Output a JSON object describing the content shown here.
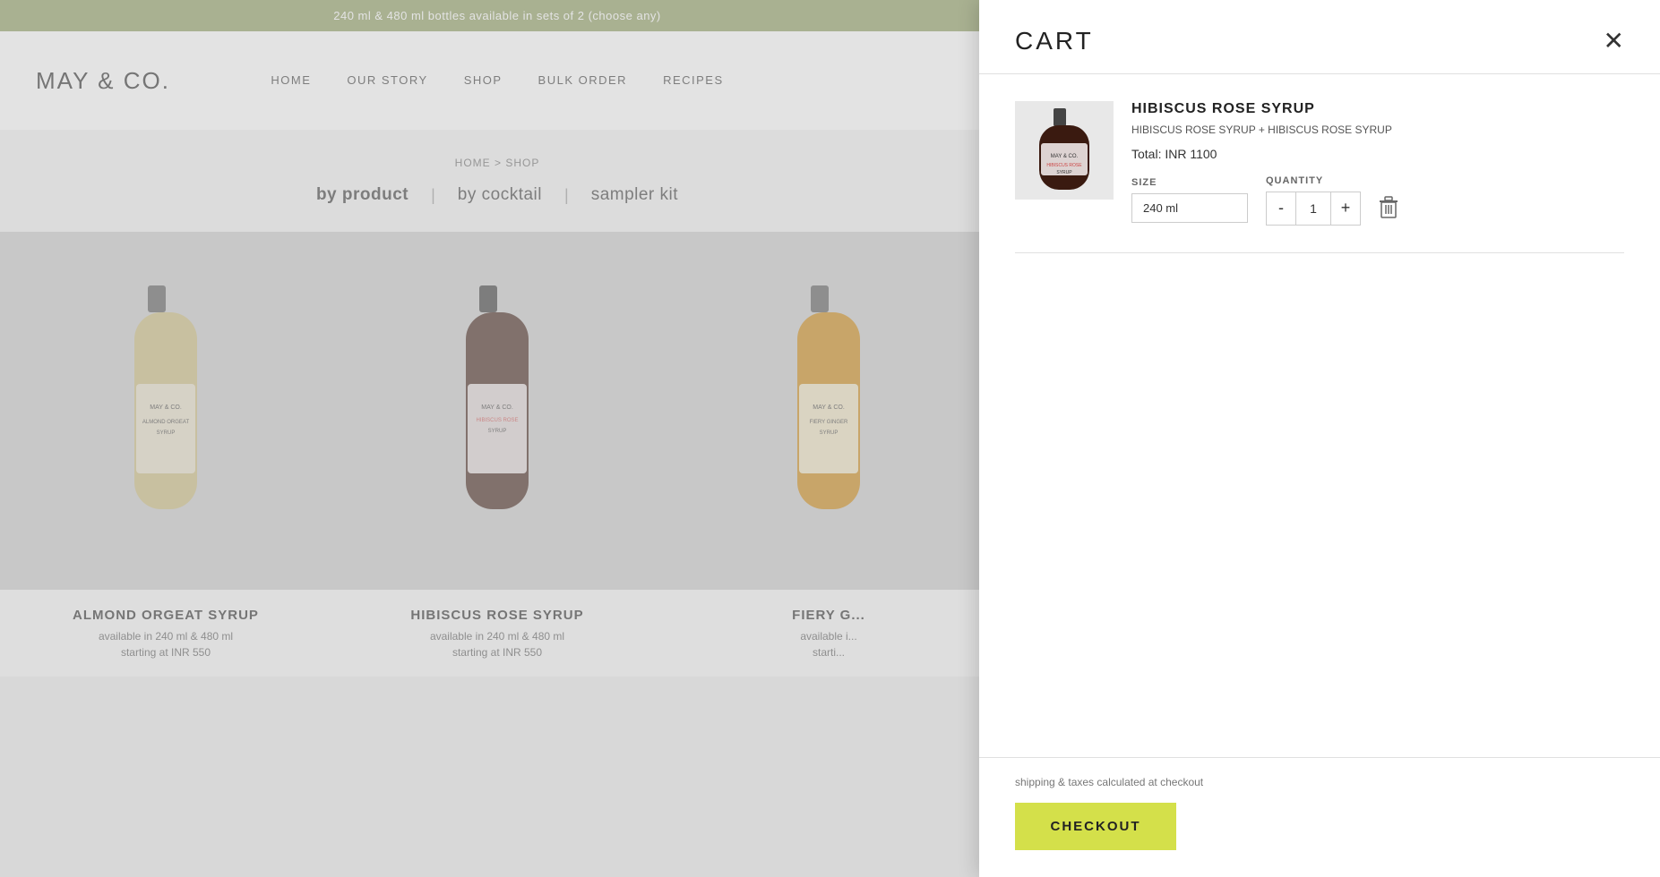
{
  "announcement": {
    "text": "240 ml & 480 ml bottles available in sets of 2 (choose any)"
  },
  "nav": {
    "logo": "MAY & CO.",
    "links": [
      "HOME",
      "OUR STORY",
      "SHOP",
      "BULK ORDER",
      "RECIPES"
    ]
  },
  "breadcrumb": {
    "path": "HOME > SHOP"
  },
  "filter_tabs": [
    {
      "label": "by product",
      "active": true
    },
    {
      "label": "by cocktail",
      "active": false
    },
    {
      "label": "sampler kit",
      "active": false
    }
  ],
  "products": [
    {
      "name": "ALMOND ORGEAT SYRUP",
      "availability": "available in 240 ml & 480 ml",
      "price": "starting at INR 550",
      "bottle_color": "#c8b878",
      "label_color": "#e8e0cc"
    },
    {
      "name": "HIBISCUS ROSE SYRUP",
      "availability": "available in 240 ml & 480 ml",
      "price": "starting at INR 550",
      "bottle_color": "#3a1a10",
      "label_color": "#f0e8e8"
    },
    {
      "name": "FIERY G...",
      "availability": "available i...",
      "price": "starti...",
      "bottle_color": "#c8830a",
      "label_color": "#f0ead0"
    }
  ],
  "cart": {
    "title": "CART",
    "close_icon": "✕",
    "item": {
      "name": "HIBISCUS ROSE SYRUP",
      "description": "HIBISCUS ROSE SYRUP + HIBISCUS ROSE SYRUP",
      "total_label": "Total: INR 1100",
      "size_label": "SIZE",
      "size_value": "240 ml",
      "qty_label": "QUANTITY",
      "qty_value": "1",
      "qty_minus": "-",
      "qty_plus": "+"
    },
    "shipping_note": "shipping & taxes calculated at checkout",
    "checkout_label": "CHECKOUT"
  }
}
